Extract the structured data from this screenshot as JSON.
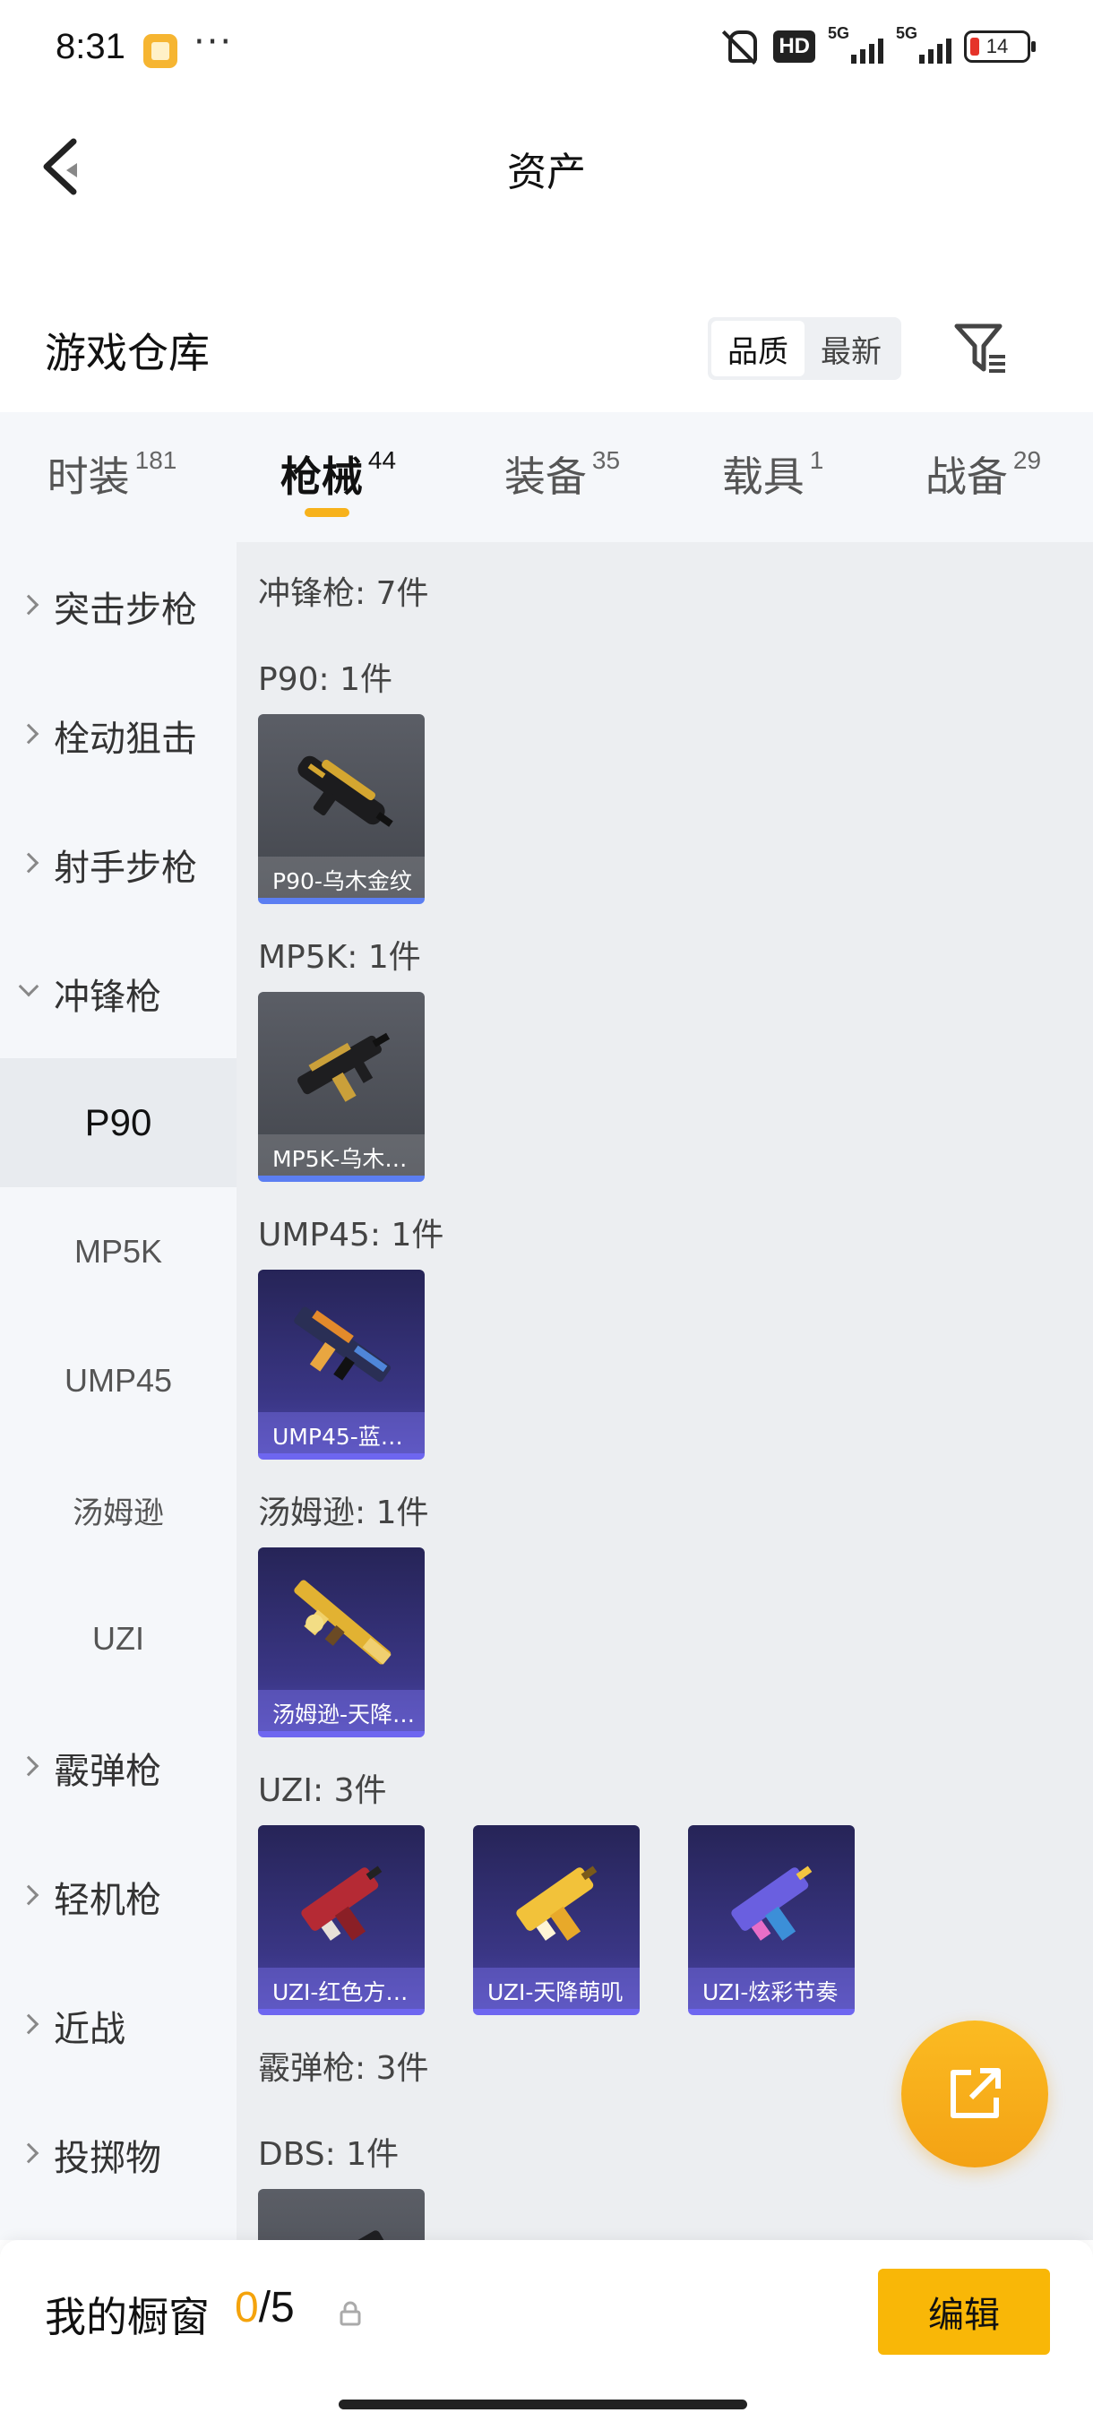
{
  "status_bar": {
    "time": "8:31",
    "dots": "···",
    "hd": "HD",
    "network_1": "5G",
    "network_2": "5G",
    "battery": "14"
  },
  "nav": {
    "title": "资产",
    "back_icon": "chevron-left-icon"
  },
  "header": {
    "title": "游戏仓库",
    "sort_options": [
      "品质",
      "最新"
    ],
    "sort_selected": "品质",
    "filter_icon": "filter-icon"
  },
  "tabs": [
    {
      "label": "时装",
      "count": "181"
    },
    {
      "label": "枪械",
      "count": "44"
    },
    {
      "label": "装备",
      "count": "35"
    },
    {
      "label": "载具",
      "count": "1"
    },
    {
      "label": "战备",
      "count": "29"
    }
  ],
  "active_tab": "枪械",
  "sidebar": {
    "items": [
      {
        "label": "突击步枪",
        "type": "group"
      },
      {
        "label": "栓动狙击",
        "type": "group"
      },
      {
        "label": "射手步枪",
        "type": "group"
      },
      {
        "label": "冲锋枪",
        "type": "group-open"
      },
      {
        "label": "P90",
        "type": "sub-active"
      },
      {
        "label": "MP5K",
        "type": "sub"
      },
      {
        "label": "UMP45",
        "type": "sub"
      },
      {
        "label": "汤姆逊",
        "type": "sub"
      },
      {
        "label": "UZI",
        "type": "sub"
      },
      {
        "label": "霰弹枪",
        "type": "group"
      },
      {
        "label": "轻机枪",
        "type": "group"
      },
      {
        "label": "近战",
        "type": "group"
      },
      {
        "label": "投掷物",
        "type": "group"
      }
    ]
  },
  "main": {
    "section_smg": "冲锋枪: 7件",
    "groups": [
      {
        "title": "P90: 1件",
        "items": [
          {
            "label": "P90-乌木金纹",
            "style": "gray"
          }
        ]
      },
      {
        "title": "MP5K: 1件",
        "items": [
          {
            "label": "MP5K-乌木…",
            "style": "gray"
          }
        ]
      },
      {
        "title": "UMP45: 1件",
        "items": [
          {
            "label": "UMP45-蓝…",
            "style": "purple"
          }
        ]
      },
      {
        "title": "汤姆逊: 1件",
        "items": [
          {
            "label": "汤姆逊-天降…",
            "style": "purple"
          }
        ]
      },
      {
        "title": "UZI: 3件",
        "items": [
          {
            "label": "UZI-红色方…",
            "style": "purple"
          },
          {
            "label": "UZI-天降萌叽",
            "style": "purple"
          },
          {
            "label": "UZI-炫彩节奏",
            "style": "purple"
          }
        ]
      }
    ],
    "section_shotgun": "霰弹枪: 3件",
    "group_dbs": "DBS: 1件"
  },
  "fab": {
    "icon": "share-external-icon"
  },
  "bottom": {
    "showcase_label": "我的橱窗",
    "showcase_current": "0",
    "showcase_total": "/5",
    "edit_label": "编辑",
    "lock_icon": "lock-icon"
  },
  "colors": {
    "accent": "#f9b707",
    "tab_indicator": "#f7b21b",
    "card_gray_bar": "#5b7ef2",
    "card_purple_bar": "#6e66f0"
  }
}
